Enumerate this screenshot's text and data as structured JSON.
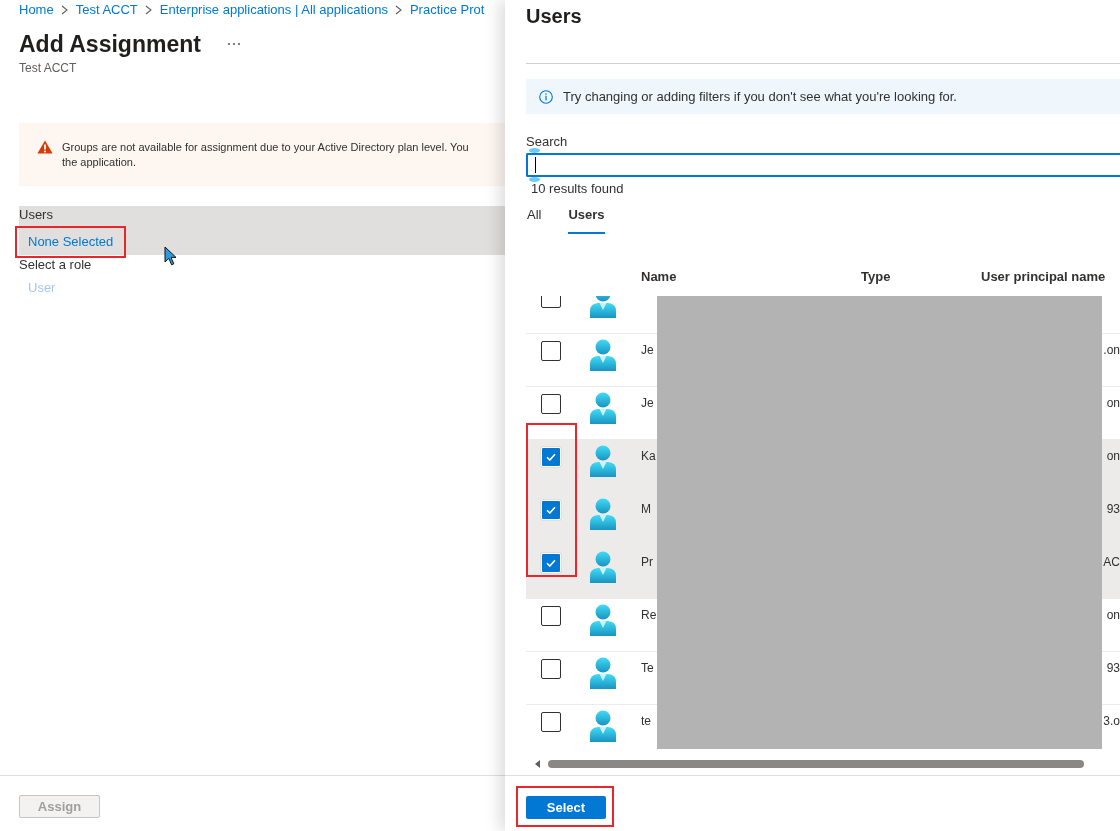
{
  "breadcrumb": [
    "Home",
    "Test ACCT",
    "Enterprise applications | All applications",
    "Practice Prot"
  ],
  "page": {
    "title": "Add Assignment",
    "subtitle": "Test ACCT"
  },
  "warning": {
    "lines": [
      "Groups are not available for assignment due to your Active Directory plan level. You",
      "the application."
    ]
  },
  "users_field": {
    "label": "Users",
    "value": "None Selected",
    "highlighted": true,
    "annotated": true
  },
  "role_field": {
    "label": "Select a role",
    "value": "User",
    "disabled": true
  },
  "footer": {
    "assign_button": {
      "label": "Assign",
      "disabled": true
    }
  },
  "panel": {
    "title": "Users",
    "info": "Try changing or adding filters if you don't see what you're looking for.",
    "search": {
      "label": "Search",
      "focused": true
    },
    "results": "10 results found",
    "tabs": [
      {
        "label": "All",
        "selected": false
      },
      {
        "label": "Users",
        "selected": true
      }
    ],
    "table": {
      "columns": [
        "Name",
        "Type",
        "User principal name"
      ],
      "rows": [
        {
          "checked": false,
          "selected": false,
          "annotated": false
        },
        {
          "checked": false,
          "selected": false,
          "annotated": false,
          "name": "Je",
          "upn": ".on"
        },
        {
          "checked": false,
          "selected": false,
          "annotated": false,
          "name": "Je",
          "upn": "on"
        },
        {
          "checked": true,
          "selected": true,
          "annotated": true,
          "name": "Ka",
          "upn": "on"
        },
        {
          "checked": true,
          "selected": true,
          "annotated": true,
          "name": "M",
          "upn": "93"
        },
        {
          "checked": true,
          "selected": true,
          "annotated": true,
          "name": "Pr",
          "upn": "AC"
        },
        {
          "checked": false,
          "selected": false,
          "annotated": false,
          "name": "Re",
          "upn": "on"
        },
        {
          "checked": false,
          "selected": false,
          "annotated": false,
          "name": "Te",
          "upn": "93"
        },
        {
          "checked": false,
          "selected": false,
          "annotated": false,
          "name": "te",
          "upn": "3.o"
        }
      ]
    },
    "select_button": {
      "label": "Select",
      "annotated": true
    }
  }
}
